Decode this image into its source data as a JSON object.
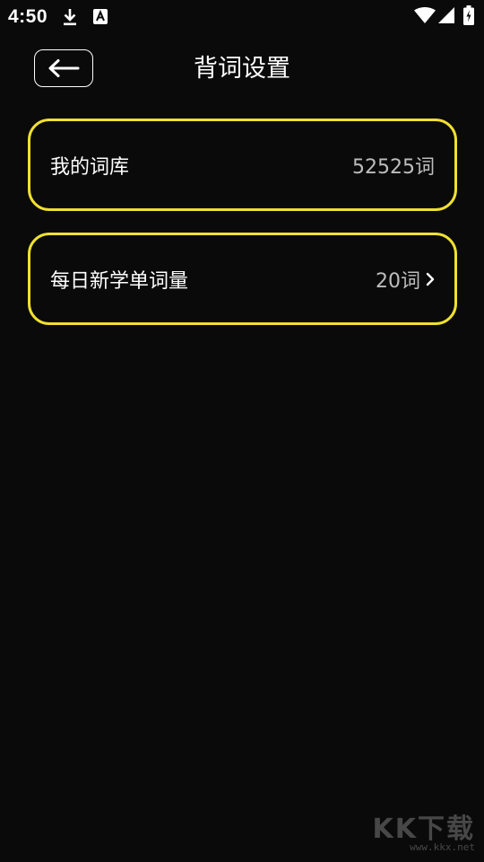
{
  "status_bar": {
    "time": "4:50",
    "icons": [
      "download-icon",
      "text-a-icon",
      "wifi-icon",
      "cell-signal-icon",
      "battery-charging-icon"
    ]
  },
  "header": {
    "back_icon": "arrow-left-icon",
    "title": "背词设置"
  },
  "settings": [
    {
      "label": "我的词库",
      "value": "52525词",
      "has_chevron": false
    },
    {
      "label": "每日新学单词量",
      "value": "20词",
      "has_chevron": true
    }
  ],
  "watermark": {
    "logo": "KK下载",
    "url": "www.kkx.net"
  },
  "colors": {
    "background": "#0a0a0a",
    "card_border": "#f0e030",
    "text_primary": "#ffffff",
    "text_secondary": "#bdbdbd"
  }
}
